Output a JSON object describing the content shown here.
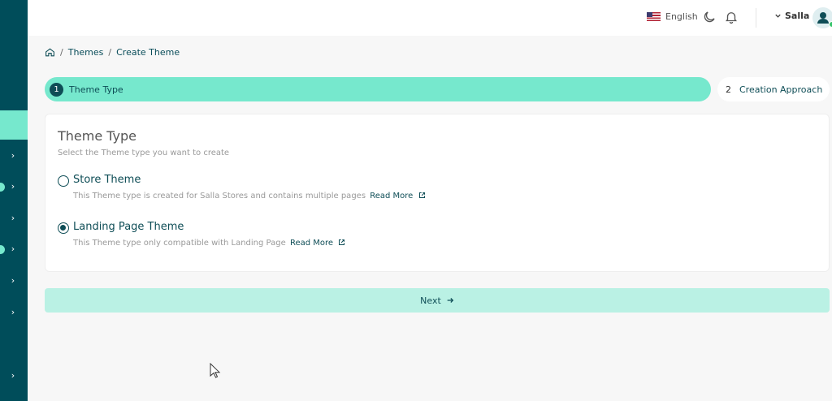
{
  "header": {
    "language": "English",
    "user_name": "Salla"
  },
  "breadcrumb": {
    "items": [
      "Themes",
      "Create Theme"
    ],
    "separator": "/"
  },
  "stepper": {
    "steps": [
      {
        "number": "1",
        "label": "Theme Type",
        "active": true
      },
      {
        "number": "2",
        "label": "Creation Approach",
        "active": false
      }
    ]
  },
  "card": {
    "title": "Theme Type",
    "subtitle": "Select the Theme type you want to create",
    "options": [
      {
        "label": "Store Theme",
        "description": "This Theme type is created for Salla Stores and contains multiple pages",
        "link": "Read More",
        "selected": false
      },
      {
        "label": "Landing Page Theme",
        "description": "This Theme type only compatible with Landing Page",
        "link": "Read More",
        "selected": true
      }
    ]
  },
  "actions": {
    "next_label": "Next",
    "next_icon": "arrow-right-icon"
  },
  "colors": {
    "sidebar": "#004d5a",
    "accent": "#76e8cd",
    "accent_light": "#baf1e4",
    "primary_text": "#0e4d56"
  }
}
